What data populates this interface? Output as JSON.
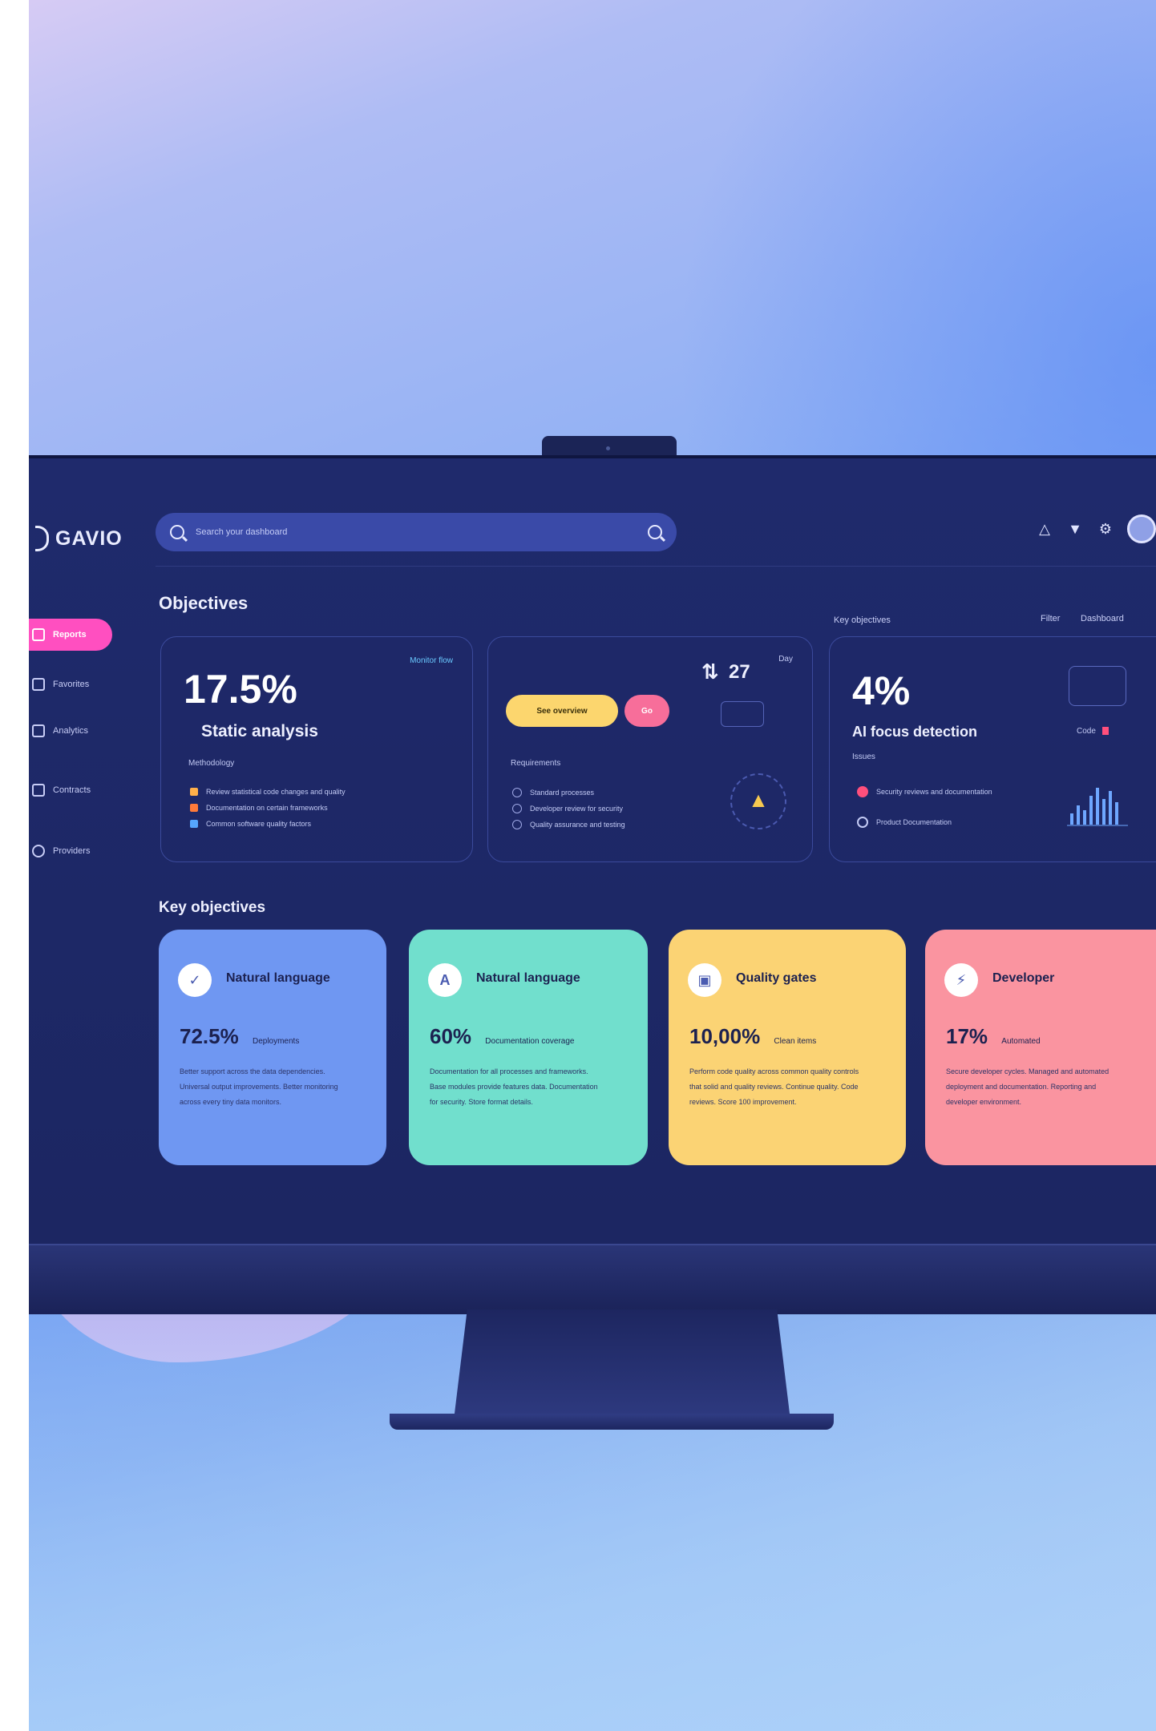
{
  "app": {
    "logo_text": "GAVIO"
  },
  "search": {
    "placeholder": "Search your dashboard"
  },
  "sidebar": {
    "items": [
      {
        "label": "Reports",
        "active": true
      },
      {
        "label": "Favorites"
      },
      {
        "label": "Analytics"
      },
      {
        "label": "Contracts"
      },
      {
        "label": "Providers"
      }
    ]
  },
  "header_icons": [
    "bell-icon",
    "filter-icon",
    "settings-icon",
    "avatar"
  ],
  "objectives": {
    "title": "Objectives",
    "right_label": "Key objectives",
    "right_links": [
      "Filter",
      "Dashboard"
    ],
    "card1": {
      "tag": "Monitor flow",
      "value": "17.5%",
      "title": "Static analysis",
      "section": "Methodology",
      "items": [
        "Review statistical code changes and quality",
        "Documentation on certain frameworks",
        "Common software quality factors"
      ]
    },
    "card2": {
      "pill_primary": "See overview",
      "pill_secondary": "Go",
      "stat": "27",
      "stat_tag": "Day",
      "section": "Requirements",
      "items": [
        "Standard processes",
        "Developer review for security",
        "Quality assurance and testing"
      ]
    },
    "card3": {
      "value": "4%",
      "title": "AI focus detection",
      "section": "Issues",
      "legend": "Code",
      "items": [
        "Security reviews and documentation",
        "Product Documentation"
      ]
    }
  },
  "key_objectives": {
    "title": "Key objectives",
    "cards": [
      {
        "title": "Natural language",
        "value": "72.5%",
        "value_label": "Deployments",
        "desc": "Better support across the data dependencies. Universal output improvements. Better monitoring across every tiny data monitors.",
        "color": "#6f97f2",
        "icon": "check-icon"
      },
      {
        "title": "Natural language",
        "value": "60%",
        "value_label": "Documentation coverage",
        "desc": "Documentation for all processes and frameworks. Base modules provide features data. Documentation for security. Store format details.",
        "color": "#71dfcd",
        "icon": "text-icon"
      },
      {
        "title": "Quality gates",
        "value": "10,00%",
        "value_label": "Clean items",
        "desc": "Perform code quality across common quality controls that solid and quality reviews. Continue quality. Code reviews. Score 100 improvement.",
        "color": "#fbd374",
        "icon": "image-icon"
      },
      {
        "title": "Developer",
        "value": "17%",
        "value_label": "Automated",
        "desc": "Secure developer cycles. Managed and automated deployment and documentation. Reporting and developer environment.",
        "color": "#fa94a0",
        "icon": "bolt-icon"
      }
    ]
  },
  "colors": {
    "accent_pink": "#ff4fc0",
    "screen_bg": "#1f2a6c"
  }
}
